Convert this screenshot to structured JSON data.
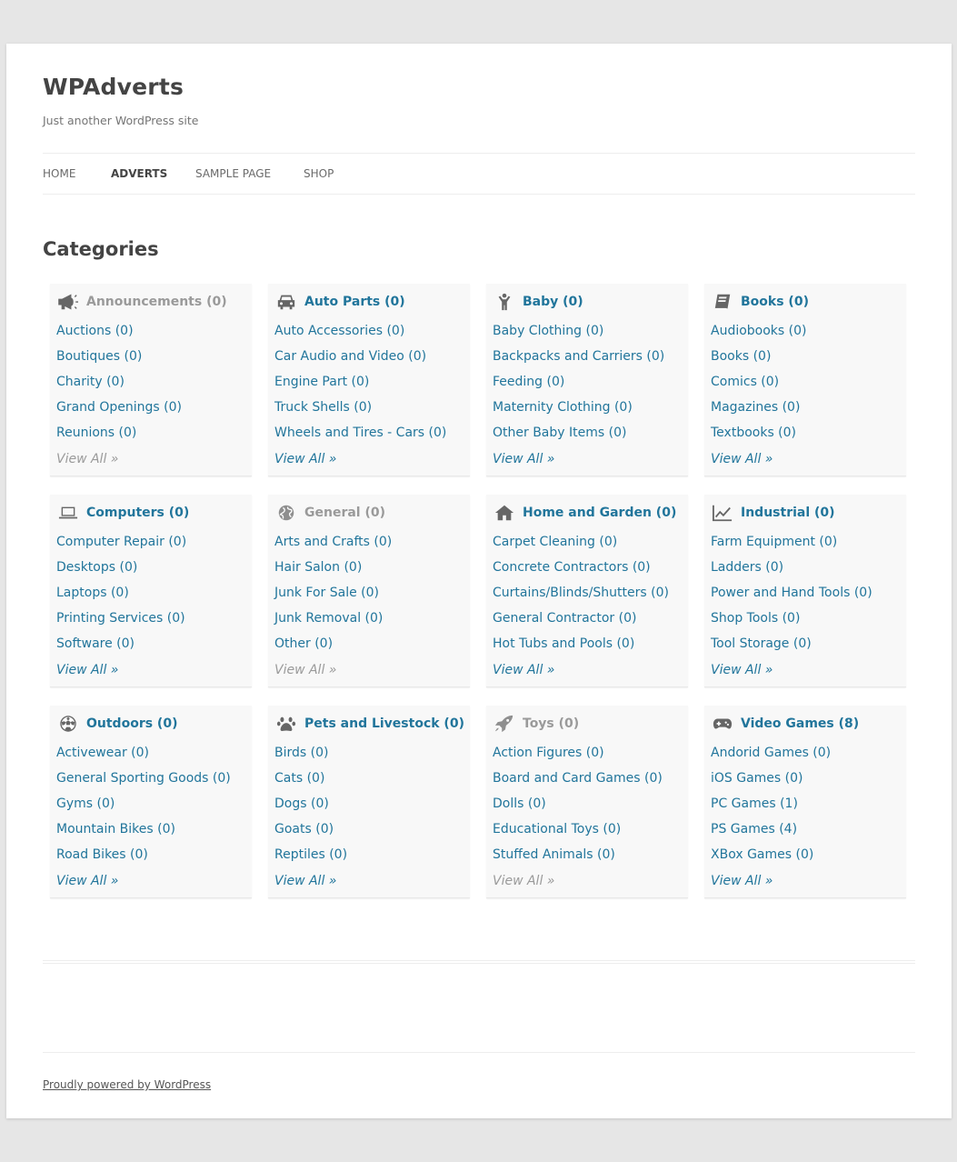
{
  "site": {
    "title": "WPAdverts",
    "tagline": "Just another WordPress site"
  },
  "nav": [
    {
      "label": "HOME",
      "active": false
    },
    {
      "label": "ADVERTS",
      "active": true
    },
    {
      "label": "SAMPLE PAGE",
      "active": false
    },
    {
      "label": "SHOP",
      "active": false
    }
  ],
  "page_title": "Categories",
  "categories": [
    {
      "name": "Announcements (0)",
      "icon": "megaphone-icon",
      "muted": true,
      "items": [
        "Auctions (0)",
        "Boutiques (0)",
        "Charity (0)",
        "Grand Openings (0)",
        "Reunions (0)"
      ],
      "view_all": "View All »",
      "view_all_muted": true
    },
    {
      "name": "Auto Parts (0)",
      "icon": "car-icon",
      "muted": false,
      "items": [
        "Auto Accessories (0)",
        "Car Audio and Video (0)",
        "Engine Part (0)",
        "Truck Shells (0)",
        "Wheels and Tires - Cars (0)"
      ],
      "view_all": "View All »",
      "view_all_muted": false
    },
    {
      "name": "Baby (0)",
      "icon": "child-icon",
      "muted": false,
      "items": [
        "Baby Clothing (0)",
        "Backpacks and Carriers (0)",
        "Feeding (0)",
        "Maternity Clothing (0)",
        "Other Baby Items (0)"
      ],
      "view_all": "View All »",
      "view_all_muted": false
    },
    {
      "name": "Books (0)",
      "icon": "book-icon",
      "muted": false,
      "items": [
        "Audiobooks (0)",
        "Books (0)",
        "Comics (0)",
        "Magazines (0)",
        "Textbooks (0)"
      ],
      "view_all": "View All »",
      "view_all_muted": false
    },
    {
      "name": "Computers (0)",
      "icon": "laptop-icon",
      "muted": false,
      "items": [
        "Computer Repair (0)",
        "Desktops (0)",
        "Laptops (0)",
        "Printing Services (0)",
        "Software (0)"
      ],
      "view_all": "View All »",
      "view_all_muted": false
    },
    {
      "name": "General (0)",
      "icon": "globe-icon",
      "muted": true,
      "items": [
        "Arts and Crafts (0)",
        "Hair Salon (0)",
        "Junk For Sale (0)",
        "Junk Removal (0)",
        "Other (0)"
      ],
      "view_all": "View All »",
      "view_all_muted": true
    },
    {
      "name": "Home and Garden (0)",
      "icon": "home-icon",
      "muted": false,
      "items": [
        "Carpet Cleaning (0)",
        "Concrete Contractors (0)",
        "Curtains/Blinds/Shutters (0)",
        "General Contractor (0)",
        "Hot Tubs and Pools (0)"
      ],
      "view_all": "View All »",
      "view_all_muted": false
    },
    {
      "name": "Industrial (0)",
      "icon": "line-chart-icon",
      "muted": false,
      "items": [
        "Farm Equipment (0)",
        "Ladders (0)",
        "Power and Hand Tools (0)",
        "Shop Tools (0)",
        "Tool Storage (0)"
      ],
      "view_all": "View All »",
      "view_all_muted": false
    },
    {
      "name": "Outdoors (0)",
      "icon": "soccer-ball-icon",
      "muted": false,
      "items": [
        "Activewear (0)",
        "General Sporting Goods (0)",
        "Gyms (0)",
        "Mountain Bikes (0)",
        "Road Bikes (0)"
      ],
      "view_all": "View All »",
      "view_all_muted": false
    },
    {
      "name": "Pets and Livestock (0)",
      "icon": "paw-icon",
      "muted": false,
      "items": [
        "Birds (0)",
        "Cats (0)",
        "Dogs (0)",
        "Goats (0)",
        "Reptiles (0)"
      ],
      "view_all": "View All »",
      "view_all_muted": false
    },
    {
      "name": "Toys (0)",
      "icon": "rocket-icon",
      "muted": true,
      "items": [
        "Action Figures (0)",
        "Board and Card Games (0)",
        "Dolls (0)",
        "Educational Toys (0)",
        "Stuffed Animals (0)"
      ],
      "view_all": "View All »",
      "view_all_muted": true
    },
    {
      "name": "Video Games (8)",
      "icon": "gamepad-icon",
      "muted": false,
      "items": [
        "Andorid Games (0)",
        "iOS Games (0)",
        "PC Games (1)",
        "PS Games (4)",
        "XBox Games (0)"
      ],
      "view_all": "View All »",
      "view_all_muted": false
    }
  ],
  "footer": {
    "credit": "Proudly powered by WordPress"
  },
  "colors": {
    "link": "#21759b",
    "muted": "#9a9a9a",
    "page_bg": "#e6e6e6"
  }
}
